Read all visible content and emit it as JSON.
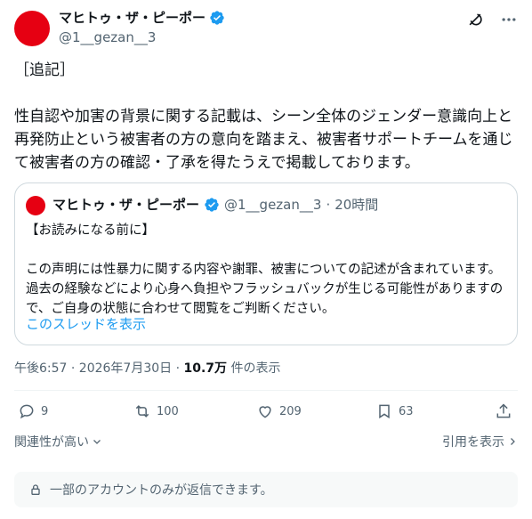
{
  "author": {
    "name": "マヒトゥ・ザ・ピーポー",
    "handle": "@1__gezan__3",
    "avatar_color": "#e60012"
  },
  "tweet": {
    "text": "［追記］\n\n性自認や加害の背景に関する記載は、シーン全体のジェンダー意識向上と再発防止という被害者の方の意向を踏まえ、被害者サポートチームを通じて被害者の方の確認・了承を得たうえで掲載しております。"
  },
  "quote": {
    "name": "マヒトゥ・ザ・ピーポー",
    "handle": "@1__gezan__3",
    "sep": "·",
    "time": "20時間",
    "text": "【お読みになる前に】\n\nこの声明には性暴力に関する内容や謝罪、被害についての記述が含まれています。過去の経験などにより心身へ負担やフラッシュバックが生じる可能性がありますので、ご自身の状態に合わせて閲覧をご判断ください。",
    "link": "このスレッドを表示"
  },
  "meta": {
    "timestamp": "午後6:57 · 2026年7月30日 · ",
    "views": "10.7万",
    "views_suffix": " 件の表示"
  },
  "actions": {
    "replies": "9",
    "retweets": "100",
    "likes": "209",
    "bookmarks": "63"
  },
  "footer": {
    "relevance": "関連性が高い",
    "view_quotes": "引用を表示",
    "notice": "一部のアカウントのみが返信できます。"
  },
  "colors": {
    "verified": "#1d9bf0",
    "link": "#1d9bf0",
    "muted": "#536471"
  }
}
